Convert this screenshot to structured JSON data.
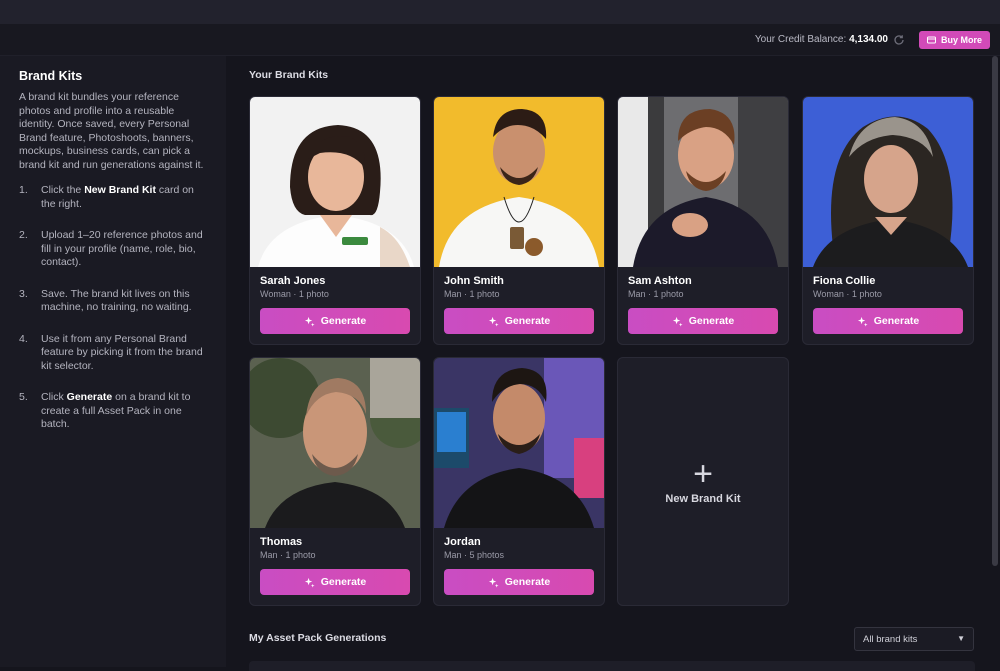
{
  "header": {
    "credit_label": "Your Credit Balance:",
    "credit_value": "4,134.00",
    "buy_label": "Buy More",
    "accent": "#d24ab8"
  },
  "sidebar": {
    "title": "Brand Kits",
    "intro": "A brand kit bundles your reference photos and profile into a reusable identity. Once saved, every Personal Brand feature, Photoshoots, banners, mockups, business cards, can pick a brand kit and run generations against it.",
    "steps": [
      {
        "num": "1.",
        "pre": "Click the ",
        "bold": "New Brand Kit",
        "post": " card on the right."
      },
      {
        "num": "2.",
        "pre": "Upload 1–20 reference photos and fill in your profile (name, role, bio, contact).",
        "bold": "",
        "post": ""
      },
      {
        "num": "3.",
        "pre": "Save. The brand kit lives on this machine, no training, no waiting.",
        "bold": "",
        "post": ""
      },
      {
        "num": "4.",
        "pre": "Use it from any Personal Brand feature by picking it from the brand kit selector.",
        "bold": "",
        "post": ""
      },
      {
        "num": "5.",
        "pre": "Click ",
        "bold": "Generate",
        "post": " on a brand kit to create a full Asset Pack in one batch."
      }
    ]
  },
  "main": {
    "section_title": "Your Brand Kits",
    "generate_label": "Generate",
    "new_kit_label": "New Brand Kit",
    "kits": [
      {
        "name": "Sarah Jones",
        "meta": "Woman · 1 photo"
      },
      {
        "name": "John Smith",
        "meta": "Man · 1 photo"
      },
      {
        "name": "Sam Ashton",
        "meta": "Man · 1 photo"
      },
      {
        "name": "Fiona Collie",
        "meta": "Woman · 1 photo"
      },
      {
        "name": "Thomas",
        "meta": "Man · 1 photo"
      },
      {
        "name": "Jordan",
        "meta": "Man · 5 photos"
      }
    ],
    "generations_title": "My Asset Pack Generations",
    "filter_value": "All brand kits"
  }
}
